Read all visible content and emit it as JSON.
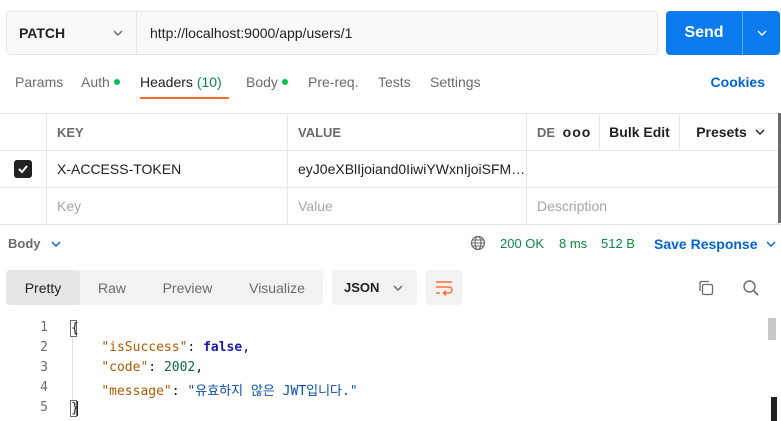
{
  "request": {
    "method": "PATCH",
    "url": "http://localhost:9000/app/users/1",
    "send_label": "Send"
  },
  "tabs": [
    {
      "label": "Params"
    },
    {
      "label": "Auth"
    },
    {
      "label": "Headers",
      "count": "(10)"
    },
    {
      "label": "Body"
    },
    {
      "label": "Pre-req."
    },
    {
      "label": "Tests"
    },
    {
      "label": "Settings"
    }
  ],
  "cookies_label": "Cookies",
  "headers_table": {
    "col_key": "KEY",
    "col_value": "VALUE",
    "col_desc": "DE",
    "more": "ooo",
    "bulk_edit": "Bulk Edit",
    "presets": "Presets",
    "rows": [
      {
        "key": "X-ACCESS-TOKEN",
        "value": "eyJ0eXBlIjoiand0IiwiYWxnIjoiSFM…",
        "checked": true
      }
    ],
    "placeholder_key": "Key",
    "placeholder_value": "Value",
    "placeholder_desc": "Description"
  },
  "response": {
    "body_label": "Body",
    "status": "200 OK",
    "time": "8 ms",
    "size": "512 B",
    "save_label": "Save Response",
    "view_tabs": [
      "Pretty",
      "Raw",
      "Preview",
      "Visualize"
    ],
    "active_view": "Pretty",
    "format": "JSON"
  },
  "code": {
    "line_numbers": [
      "1",
      "2",
      "3",
      "4",
      "5"
    ],
    "open_brace": "{",
    "close_brace": "}",
    "k1": "\"isSuccess\"",
    "v1": "false",
    "k2": "\"code\"",
    "v2": "2002",
    "k3": "\"message\"",
    "v3": "\"유효하지 않은 JWT입니다.\""
  },
  "colors": {
    "accent": "#ff6c37",
    "send": "#097bed",
    "link": "#0265d2",
    "success": "#0a8a44"
  }
}
